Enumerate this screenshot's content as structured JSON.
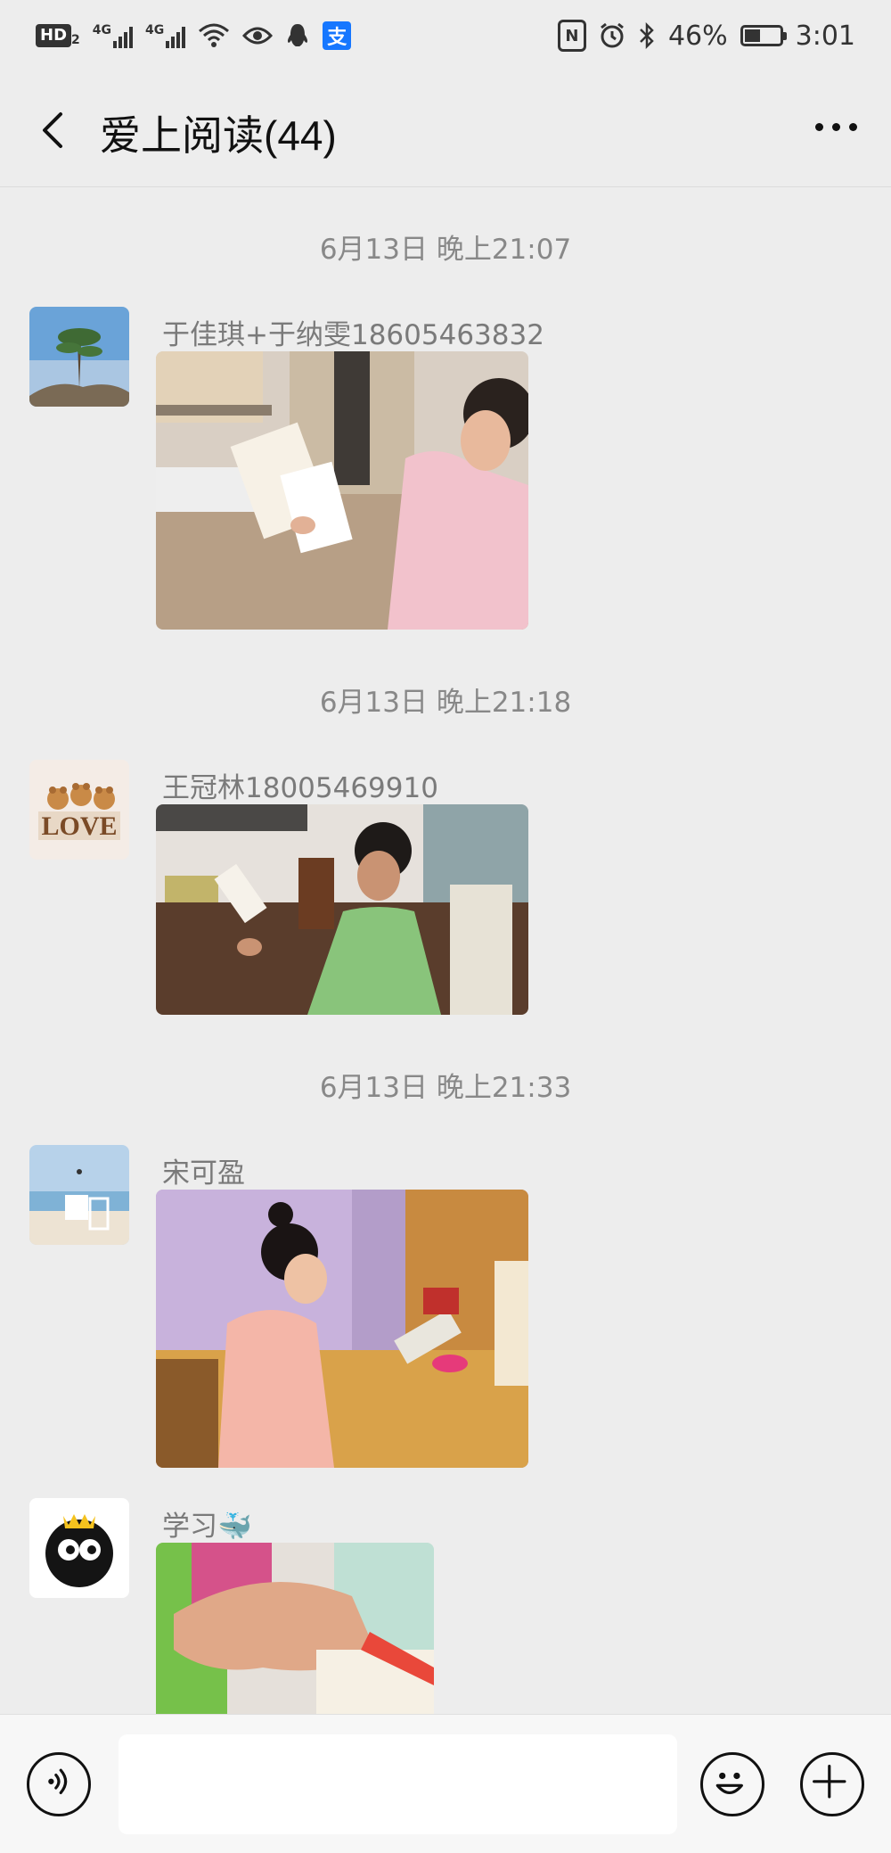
{
  "status_bar": {
    "hd": "HD",
    "hd_sub": "2",
    "net1": "4G",
    "net2": "4G",
    "nfc": "N",
    "battery_text": "46%",
    "battery_level": 0.46,
    "time": "3:01",
    "pay_glyph": "支"
  },
  "header": {
    "title": "爱上阅读(44)"
  },
  "messages": [
    {
      "timestamp": "6月13日 晚上21:07",
      "sender": "于佳琪+于纳雯18605463832"
    },
    {
      "timestamp": "6月13日 晚上21:18",
      "sender": "王冠林18005469910"
    },
    {
      "timestamp": "6月13日 晚上21:33",
      "sender": "宋可盈"
    },
    {
      "sender": "学习🐳"
    }
  ],
  "input": {
    "placeholder": ""
  },
  "icons": {
    "back": "chevron-left-icon",
    "more": "more-dots-icon",
    "voice": "voice-icon",
    "emoji": "emoji-icon",
    "plus": "plus-icon"
  }
}
